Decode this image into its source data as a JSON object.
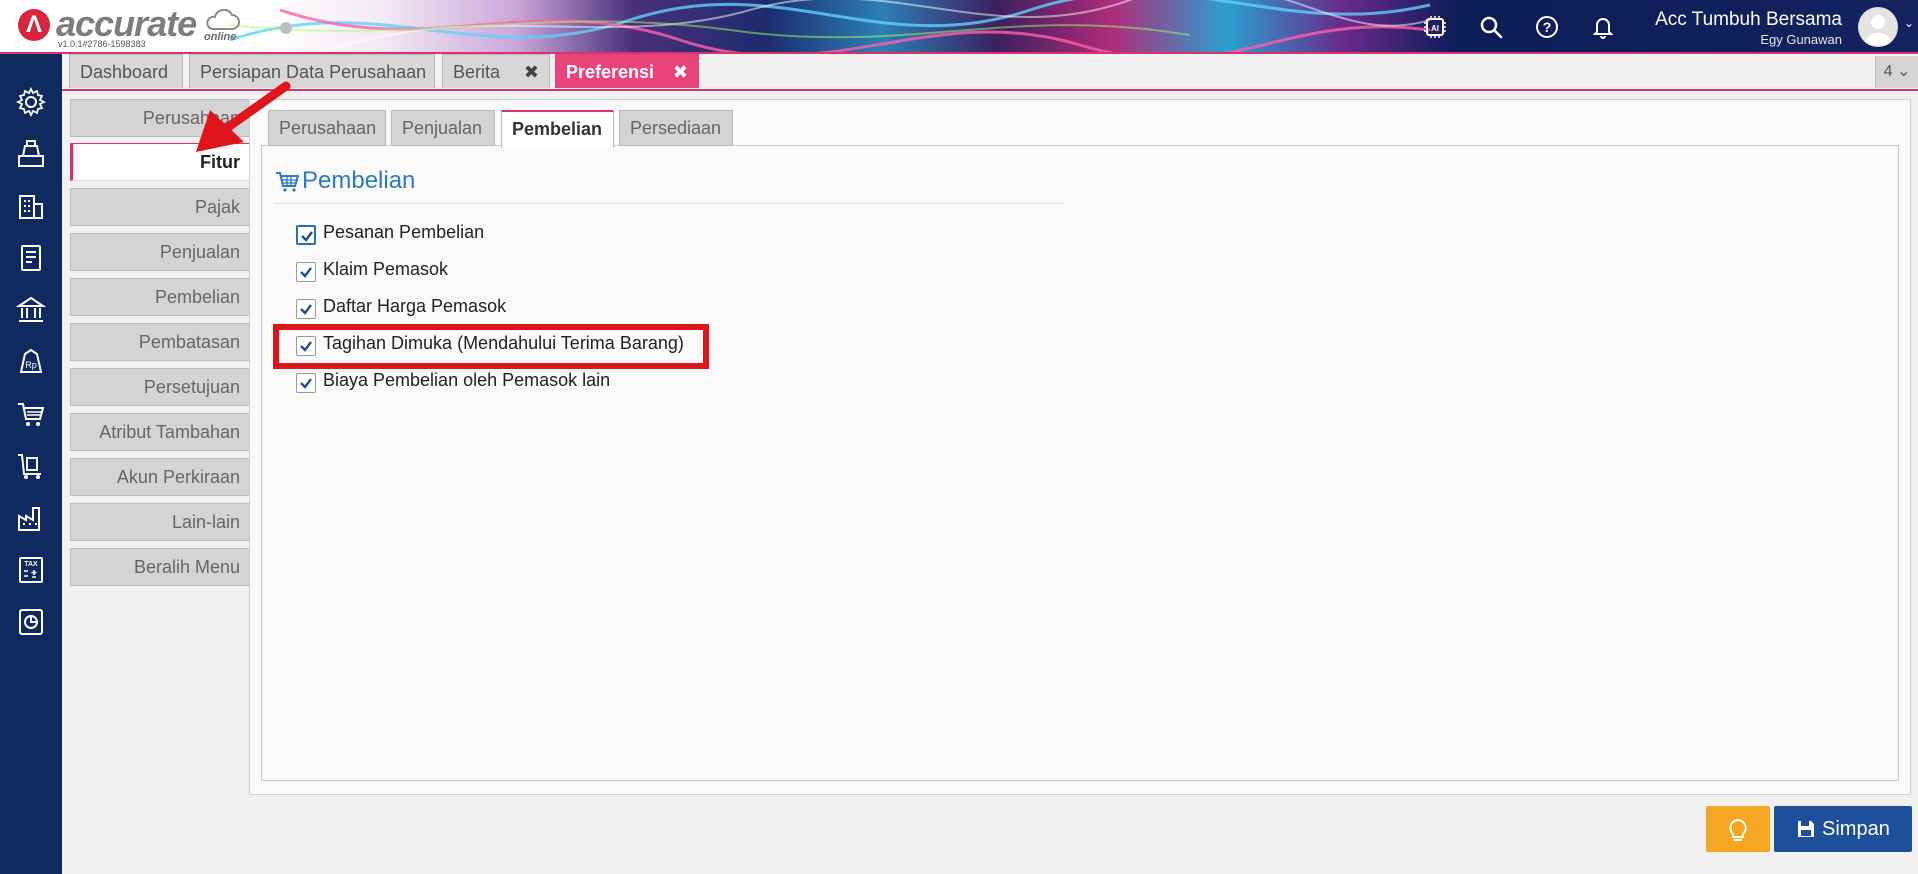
{
  "app": {
    "logo_text": "accurate",
    "logo_sub": "online",
    "version": "v1.0.1#2786-1598383",
    "company": "Acc Tumbuh Bersama",
    "user": "Egy Gunawan"
  },
  "header_icons": [
    "ai-chip-icon",
    "search-icon",
    "help-icon",
    "bell-icon"
  ],
  "tabs": [
    {
      "label": "Dashboard",
      "closable": false
    },
    {
      "label": "Persiapan Data Perusahaan",
      "closable": false
    },
    {
      "label": "Berita",
      "closable": true
    },
    {
      "label": "Preferensi",
      "closable": true,
      "active": true
    }
  ],
  "tab_close_glyph": "✖",
  "tab_count": "4 ⌄",
  "side_menu": [
    {
      "label": "Perusahaan"
    },
    {
      "label": "Fitur",
      "active": true
    },
    {
      "label": "Pajak"
    },
    {
      "label": "Penjualan"
    },
    {
      "label": "Pembelian"
    },
    {
      "label": "Pembatasan"
    },
    {
      "label": "Persetujuan"
    },
    {
      "label": "Atribut Tambahan"
    },
    {
      "label": "Akun Perkiraan"
    },
    {
      "label": "Lain-lain"
    },
    {
      "label": "Beralih Menu"
    }
  ],
  "sub_tabs": [
    {
      "label": "Perusahaan"
    },
    {
      "label": "Penjualan"
    },
    {
      "label": "Pembelian",
      "active": true
    },
    {
      "label": "Persediaan"
    }
  ],
  "section": {
    "title": "Pembelian",
    "icon": "cart-icon"
  },
  "options": [
    {
      "label": "Pesanan Pembelian",
      "checked": true
    },
    {
      "label": "Klaim Pemasok",
      "checked": true
    },
    {
      "label": "Daftar Harga Pemasok",
      "checked": true
    },
    {
      "label": "Tagihan Dimuka (Mendahului Terima Barang)",
      "checked": true,
      "highlighted": true
    },
    {
      "label": "Biaya Pembelian oleh Pemasok lain",
      "checked": true
    }
  ],
  "buttons": {
    "save": "Simpan"
  },
  "colors": {
    "accent": "#d8336d",
    "nav_bg": "#0f2a5e",
    "save_bg": "#1d4f9a",
    "hint_bg": "#f5a623",
    "section_title": "#2c7bbf",
    "highlight_box": "#e0141b"
  }
}
